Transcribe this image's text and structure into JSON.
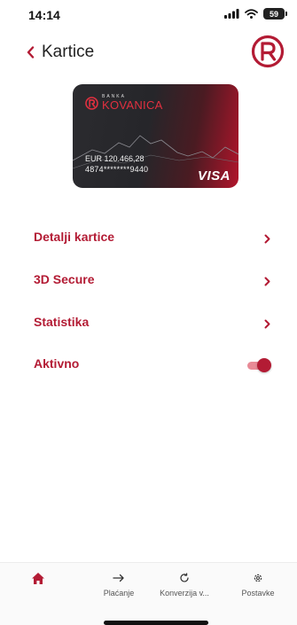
{
  "status_bar": {
    "time": "14:14",
    "battery": "59"
  },
  "header": {
    "back_label": "Kartice"
  },
  "card": {
    "bank_small": "BANKA",
    "bank_name": "KOVANICA",
    "balance": "EUR 120.466,28",
    "number": "4874********9440",
    "network": "VISA"
  },
  "menu": {
    "items": [
      {
        "label": "Detalji kartice"
      },
      {
        "label": "3D Secure"
      },
      {
        "label": "Statistika"
      }
    ],
    "toggle": {
      "label": "Aktivno",
      "state": true
    }
  },
  "bottom_nav": {
    "items": [
      {
        "label": ""
      },
      {
        "label": "Plaćanje"
      },
      {
        "label": "Konverzija v..."
      },
      {
        "label": "Postavke"
      }
    ]
  },
  "colors": {
    "accent": "#b31b34",
    "toggle_track": "#e88a96",
    "nav_active": "#b31b34"
  },
  "icons": {
    "back": "chevron-left-icon",
    "logo": "kovanica-logo",
    "menu_arrow": "chevron-right-icon",
    "home": "home-icon",
    "payment": "arrow-right-icon",
    "conversion": "refresh-icon",
    "settings": "gear-icon"
  }
}
